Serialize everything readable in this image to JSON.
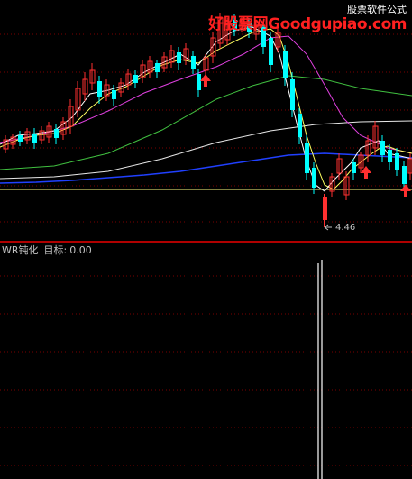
{
  "watermark": {
    "brand": "好股票网Goodgupiao.com",
    "tag": "股票软件公式"
  },
  "price_panel": {
    "low_label": "4.46"
  },
  "indicator_panel": {
    "name": "WR钝化",
    "target_label": "目标:",
    "target_value": "0.00"
  },
  "colors": {
    "background": "#000000",
    "up_candle": "#ff3030",
    "down_candle": "#00ffff",
    "grid": "#8b0000",
    "signal_arrow": "#ff3030",
    "wr_signal": "#ffffff"
  },
  "icons": [
    "up-arrow-icon"
  ]
}
